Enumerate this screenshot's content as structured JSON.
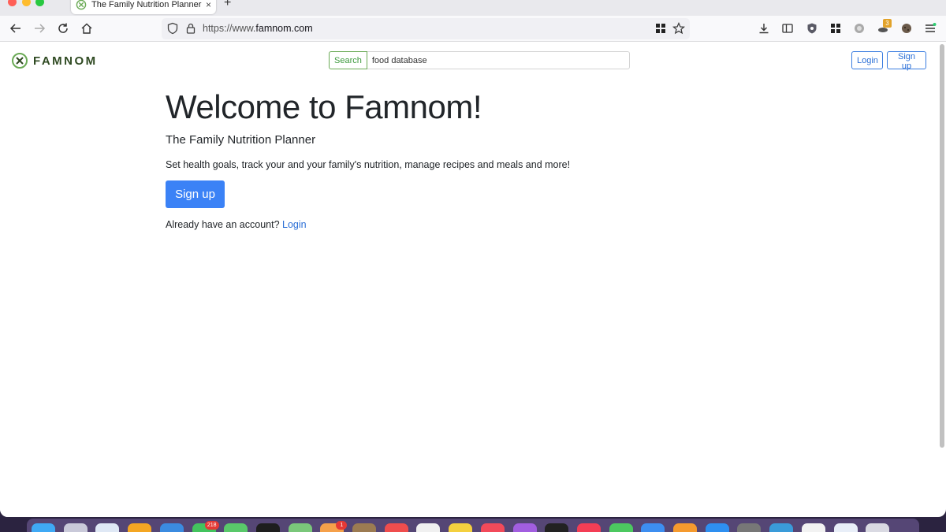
{
  "browser": {
    "tab_title": "The Family Nutrition Planner - F",
    "tab_close": "×",
    "new_tab": "+",
    "url_prefix": "https://www.",
    "url_domain": "famnom.com",
    "extension_badge": "3"
  },
  "site": {
    "logo_text": "FAMNOM",
    "search": {
      "button_label": "Search",
      "value": "food database"
    },
    "nav": {
      "login_label": "Login",
      "signup_label": "Sign up"
    }
  },
  "hero": {
    "title": "Welcome to Famnom!",
    "subtitle": "The Family Nutrition Planner",
    "description": "Set health goals, track your and your family's nutrition, manage recipes and meals and more!",
    "signup_label": "Sign up",
    "login_prompt": "Already have an account?",
    "login_link": "Login"
  },
  "dock": {
    "icons": [
      {
        "name": "finder",
        "color": "#3fa9f5"
      },
      {
        "name": "launchpad",
        "color": "#c9c9d9"
      },
      {
        "name": "safari",
        "color": "#dfe8f5"
      },
      {
        "name": "sketch",
        "color": "#f4a623"
      },
      {
        "name": "calendar-app",
        "color": "#3b8be0"
      },
      {
        "name": "messages",
        "color": "#43c35e",
        "badge": "218"
      },
      {
        "name": "facetime",
        "color": "#59c86a"
      },
      {
        "name": "terminal",
        "color": "#1e1e1e"
      },
      {
        "name": "maps",
        "color": "#7ac77a"
      },
      {
        "name": "photos",
        "color": "#f5a04a",
        "badge": "1"
      },
      {
        "name": "notes-brown",
        "color": "#9c7b52"
      },
      {
        "name": "calendar",
        "color": "#ef4d4d"
      },
      {
        "name": "reminders",
        "color": "#f0f0f0"
      },
      {
        "name": "stickies",
        "color": "#f4d03f"
      },
      {
        "name": "music",
        "color": "#f24a5a"
      },
      {
        "name": "podcasts",
        "color": "#a25ee0"
      },
      {
        "name": "tv",
        "color": "#222222"
      },
      {
        "name": "news",
        "color": "#f33e55"
      },
      {
        "name": "numbers",
        "color": "#4cc860"
      },
      {
        "name": "keynote",
        "color": "#3d8ef0"
      },
      {
        "name": "pages",
        "color": "#f59a2e"
      },
      {
        "name": "xcode",
        "color": "#2e8ff0"
      },
      {
        "name": "settings",
        "color": "#777777"
      },
      {
        "name": "vscode",
        "color": "#3a9bd9"
      },
      {
        "name": "firefox-alt",
        "color": "#f2f2f2"
      },
      {
        "name": "chrome",
        "color": "#e8eef8"
      },
      {
        "name": "trash",
        "color": "#d9d9e2"
      }
    ]
  },
  "colors": {
    "brand_green": "#2f4a22",
    "primary_blue": "#3b82f6",
    "link_blue": "#2b6fd6"
  }
}
